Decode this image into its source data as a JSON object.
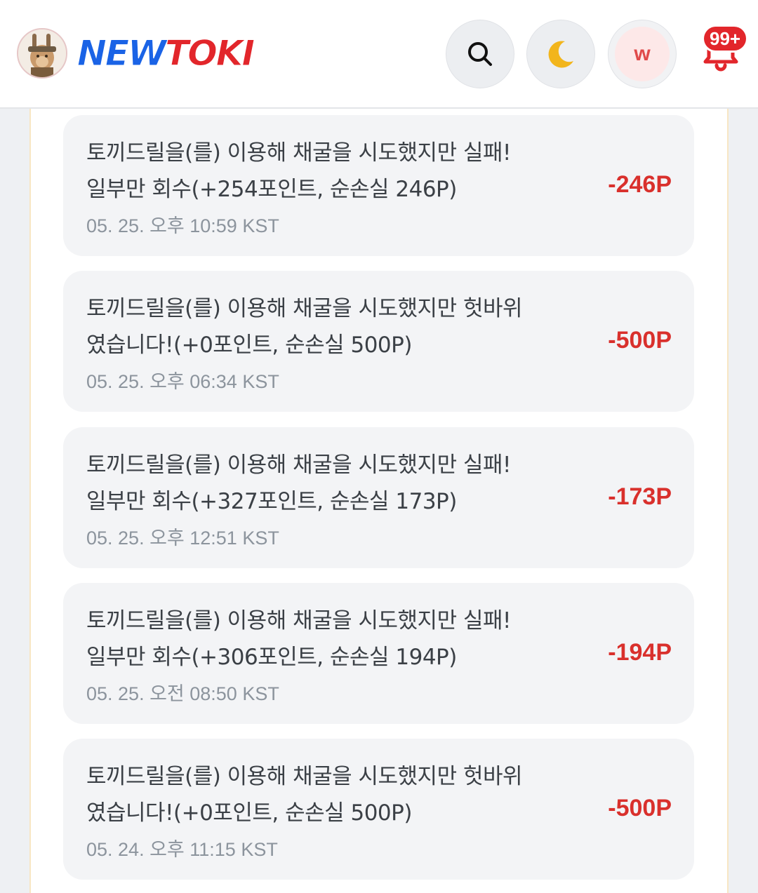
{
  "header": {
    "logo_text_a": "NEW",
    "logo_text_b": "TOKI",
    "search_icon": "search-icon",
    "dark_mode_icon": "moon-icon",
    "user_initial": "w",
    "notification_badge": "99+",
    "colors": {
      "brand_blue": "#1a63e6",
      "brand_red": "#e2262b",
      "amount_red": "#d9302c"
    }
  },
  "history": [
    {
      "line1": "토끼드릴을(를) 이용해 채굴을 시도했지만 실패!",
      "line2": "일부만 회수(+254포인트, 순손실 246P)",
      "time": "05. 25. 오후 10:59 KST",
      "amount": "-246P"
    },
    {
      "line1": "토끼드릴을(를) 이용해 채굴을 시도했지만 헛바위",
      "line2": "였습니다!(+0포인트, 순손실 500P)",
      "time": "05. 25. 오후 06:34 KST",
      "amount": "-500P"
    },
    {
      "line1": "토끼드릴을(를) 이용해 채굴을 시도했지만 실패!",
      "line2": "일부만 회수(+327포인트, 순손실 173P)",
      "time": "05. 25. 오후 12:51 KST",
      "amount": "-173P"
    },
    {
      "line1": "토끼드릴을(를) 이용해 채굴을 시도했지만 실패!",
      "line2": "일부만 회수(+306포인트, 순손실 194P)",
      "time": "05. 25. 오전 08:50 KST",
      "amount": "-194P"
    },
    {
      "line1": "토끼드릴을(를) 이용해 채굴을 시도했지만 헛바위",
      "line2": "였습니다!(+0포인트, 순손실 500P)",
      "time": "05. 24. 오후 11:15 KST",
      "amount": "-500P"
    }
  ]
}
